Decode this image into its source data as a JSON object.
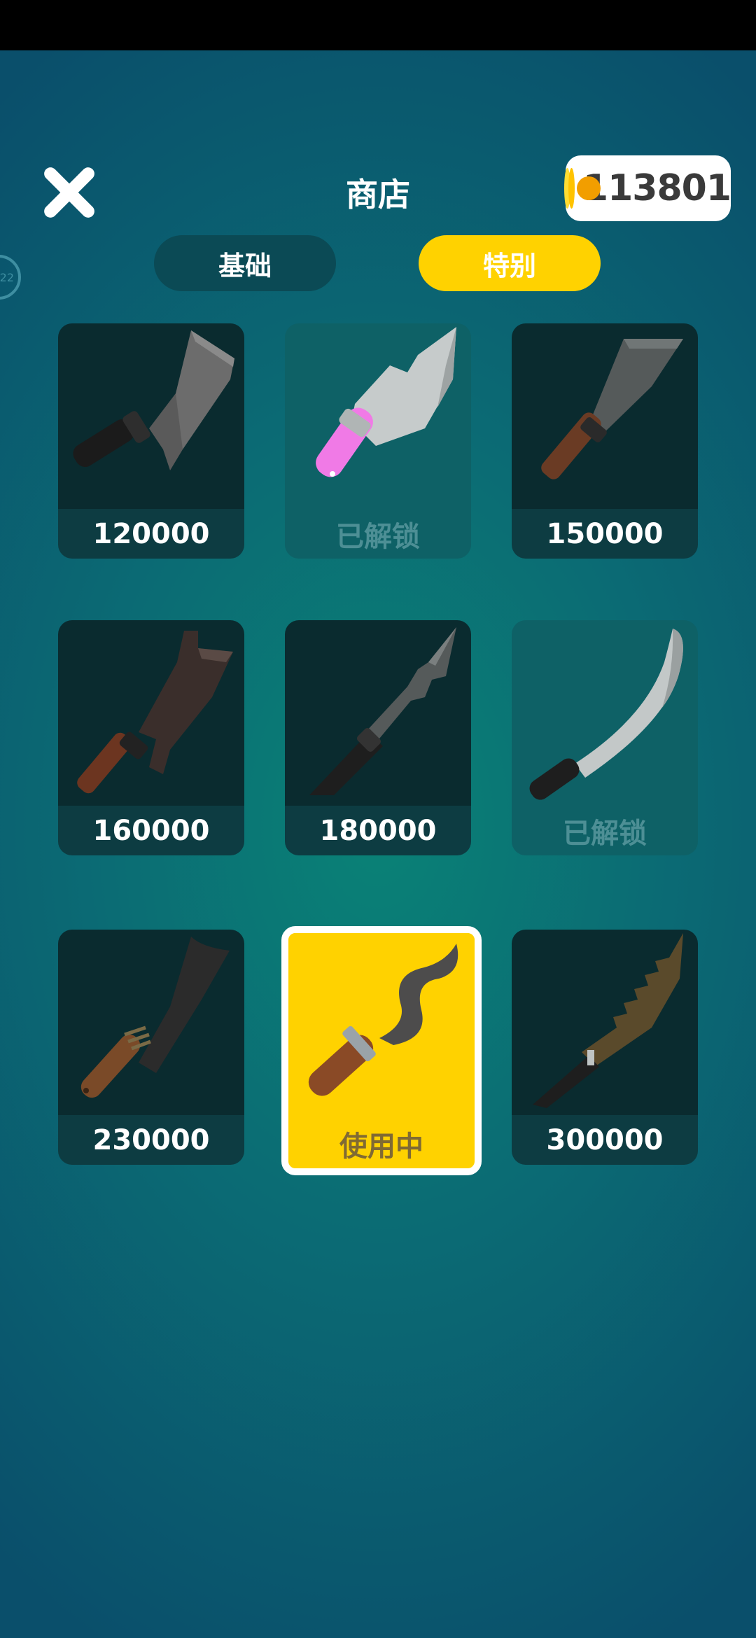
{
  "header": {
    "title": "商店",
    "coins": "113801",
    "side_badge": "22"
  },
  "tabs": [
    {
      "label": "基础",
      "active": false
    },
    {
      "label": "特别",
      "active": true
    }
  ],
  "items": [
    {
      "price": "120000",
      "state": "locked",
      "icon": "cleaver-knife-icon"
    },
    {
      "price": "已解锁",
      "state": "owned",
      "icon": "pink-handle-knife-icon"
    },
    {
      "price": "150000",
      "state": "locked",
      "icon": "chef-knife-icon"
    },
    {
      "price": "160000",
      "state": "locked",
      "icon": "hooked-cleaver-icon"
    },
    {
      "price": "180000",
      "state": "locked",
      "icon": "serrated-blade-icon"
    },
    {
      "price": "已解锁",
      "state": "owned",
      "icon": "curved-machete-icon"
    },
    {
      "price": "230000",
      "state": "locked",
      "icon": "bound-cleaver-icon"
    },
    {
      "price": "使用中",
      "state": "in-use",
      "icon": "kris-dagger-icon"
    },
    {
      "price": "300000",
      "state": "locked",
      "icon": "saw-back-knife-icon"
    }
  ],
  "colors": {
    "accent": "#ffd200",
    "card_dark": "#0a2b2f",
    "card_owned": "#0e6166"
  }
}
